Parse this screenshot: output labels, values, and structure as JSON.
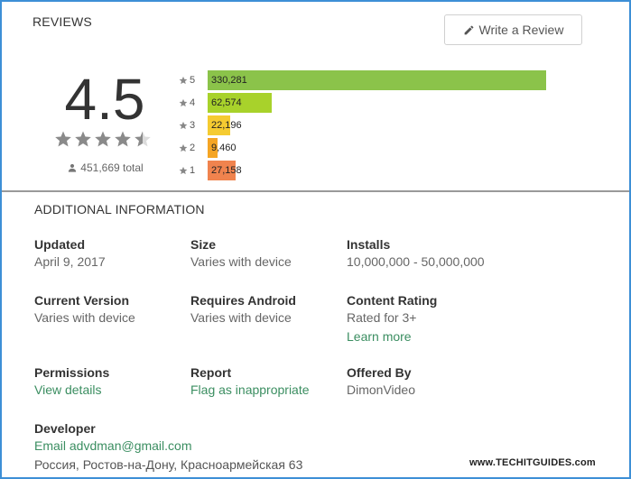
{
  "reviews": {
    "title": "REVIEWS",
    "write_button": "Write a Review",
    "score": "4.5",
    "stars": [
      1,
      1,
      1,
      1,
      0.5
    ],
    "total": "451,669 total",
    "histogram": [
      {
        "star": "5",
        "count": "330,281",
        "value": 330281,
        "color": "#8bc34a"
      },
      {
        "star": "4",
        "count": "62,574",
        "value": 62574,
        "color": "#a8d22b"
      },
      {
        "star": "3",
        "count": "22,196",
        "value": 22196,
        "color": "#f5cb31"
      },
      {
        "star": "2",
        "count": "9,460",
        "value": 9460,
        "color": "#f5a524"
      },
      {
        "star": "1",
        "count": "27,158",
        "value": 27158,
        "color": "#f0834e"
      }
    ]
  },
  "additional": {
    "title": "ADDITIONAL INFORMATION",
    "updated_label": "Updated",
    "updated_value": "April 9, 2017",
    "size_label": "Size",
    "size_value": "Varies with device",
    "installs_label": "Installs",
    "installs_value": "10,000,000 - 50,000,000",
    "version_label": "Current Version",
    "version_value": "Varies with device",
    "android_label": "Requires Android",
    "android_value": "Varies with device",
    "rating_label": "Content Rating",
    "rating_value": "Rated for 3+",
    "rating_link": "Learn more",
    "permissions_label": "Permissions",
    "permissions_link": "View details",
    "report_label": "Report",
    "report_link": "Flag as inappropriate",
    "offered_label": "Offered By",
    "offered_value": "DimonVideo",
    "developer_label": "Developer",
    "developer_email": "Email advdman@gmail.com",
    "developer_address": "Россия, Ростов-на-Дону, Красноармейская 63"
  },
  "watermark": "www.TECHITGUIDES.com",
  "colors": {
    "star_gray": "#8a8a8a",
    "link_green": "#3b8e61",
    "frame_blue": "#3d8fd6"
  }
}
